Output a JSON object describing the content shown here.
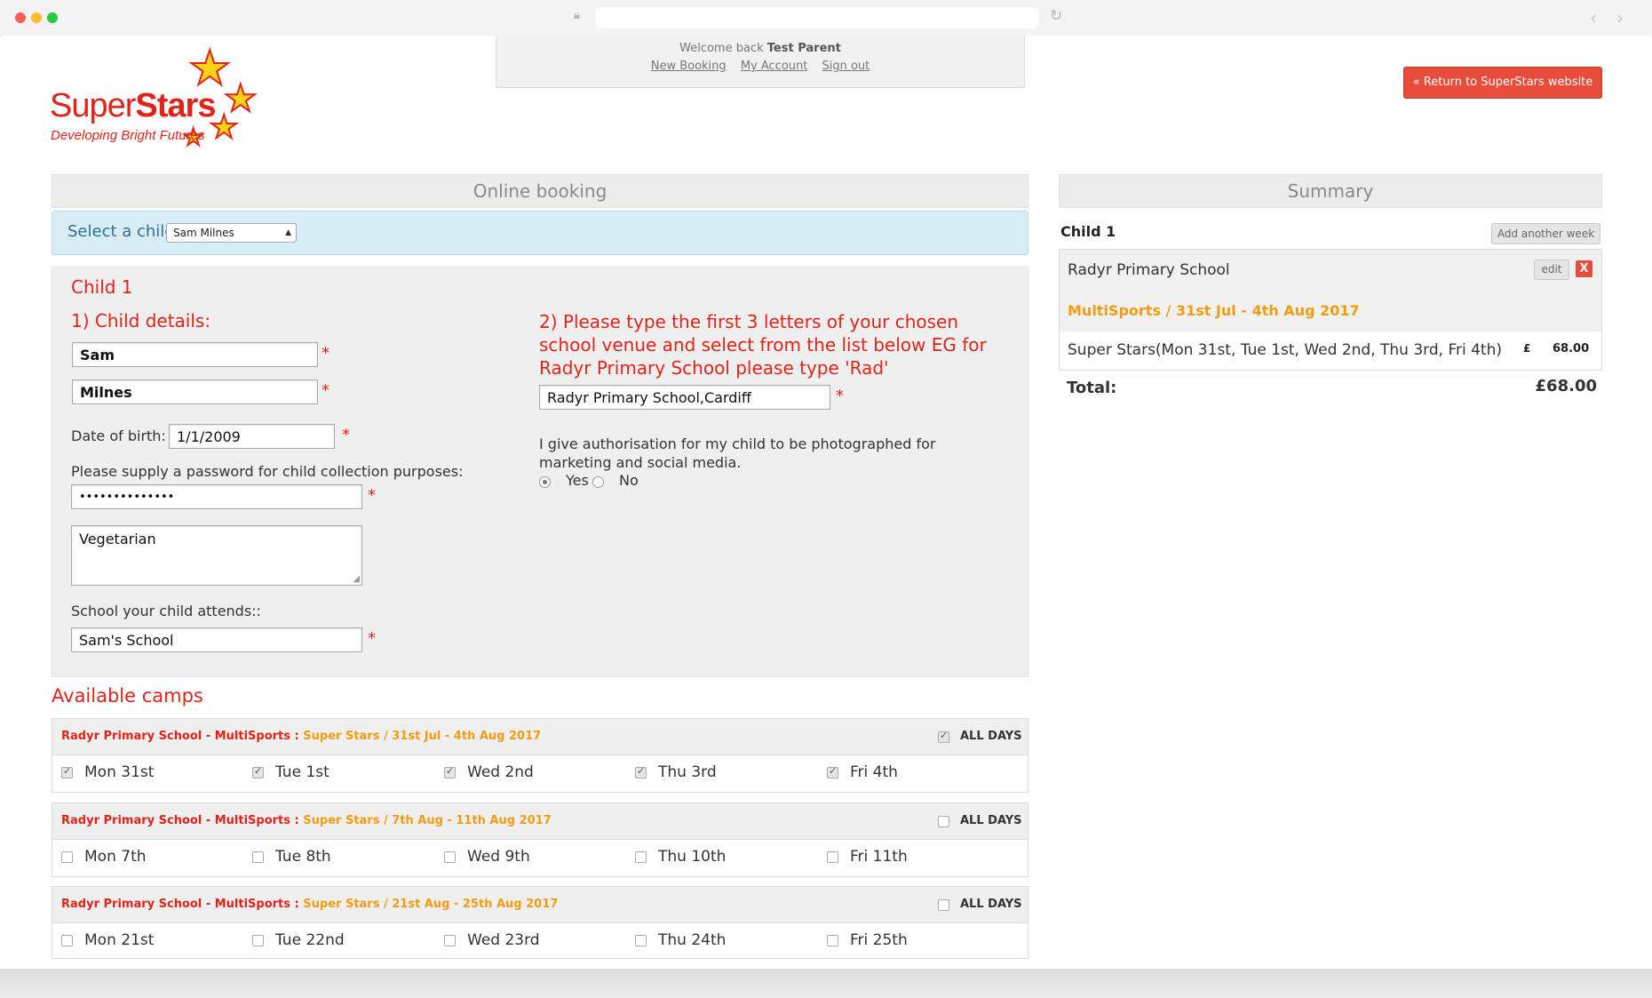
{
  "header": {
    "welcome_prefix": "Welcome back",
    "user_name": "Test Parent",
    "links": [
      "New Booking",
      "My Account",
      "Sign out"
    ],
    "return_button": "« Return to SuperStars website"
  },
  "logo": {
    "name_regular": "Super",
    "name_bold": "Stars",
    "tagline": "Developing Bright Futures"
  },
  "booking": {
    "title": "Online booking",
    "select_child_label": "Select a child",
    "select_child_value": "Sam Milnes",
    "child_title": "Child 1",
    "section1_title": "1) Child details:",
    "first_name": "Sam",
    "last_name": "Milnes",
    "dob_label": "Date of birth:",
    "dob_value": "1/1/2009",
    "password_label": "Please supply a password for child collection purposes:",
    "password_value": "••••••••••••••",
    "notes_value": "Vegetarian",
    "school_label": "School your child attends::",
    "school_value": "Sam's School",
    "section2_title": "2) Please type the first 3 letters of your chosen school venue and select from the list below EG for Radyr Primary School please type 'Rad'",
    "venue_value": "Radyr Primary School,Cardiff",
    "photo_consent_text": "I give authorisation for my child to be photographed for marketing and social media.",
    "photo_yes": "Yes",
    "photo_no": "No",
    "photo_selected": "Yes",
    "required_mark": "*"
  },
  "camps": {
    "title": "Available camps",
    "all_days_label": "ALL DAYS",
    "items": [
      {
        "venue": "Radyr Primary School - MultiSports",
        "week": "Super Stars / 31st Jul - 4th Aug 2017",
        "all_checked": true,
        "days": [
          {
            "label": "Mon 31st",
            "checked": true
          },
          {
            "label": "Tue 1st",
            "checked": true
          },
          {
            "label": "Wed 2nd",
            "checked": true
          },
          {
            "label": "Thu 3rd",
            "checked": true
          },
          {
            "label": "Fri 4th",
            "checked": true
          }
        ]
      },
      {
        "venue": "Radyr Primary School - MultiSports",
        "week": "Super Stars / 7th Aug - 11th Aug 2017",
        "all_checked": false,
        "days": [
          {
            "label": "Mon 7th",
            "checked": false
          },
          {
            "label": "Tue 8th",
            "checked": false
          },
          {
            "label": "Wed 9th",
            "checked": false
          },
          {
            "label": "Thu 10th",
            "checked": false
          },
          {
            "label": "Fri 11th",
            "checked": false
          }
        ]
      },
      {
        "venue": "Radyr Primary School - MultiSports",
        "week": "Super Stars / 21st Aug - 25th Aug 2017",
        "all_checked": false,
        "days": [
          {
            "label": "Mon 21st",
            "checked": false
          },
          {
            "label": "Tue 22nd",
            "checked": false
          },
          {
            "label": "Wed 23rd",
            "checked": false
          },
          {
            "label": "Thu 24th",
            "checked": false
          },
          {
            "label": "Fri 25th",
            "checked": false
          }
        ]
      }
    ]
  },
  "summary": {
    "title": "Summary",
    "child_label": "Child 1",
    "add_week_button": "Add another week",
    "school": "Radyr Primary School",
    "edit_button": "edit",
    "remove_button": "X",
    "camp_title": "MultiSports / 31st Jul - 4th Aug 2017",
    "line_item": "Super Stars(Mon 31st, Tue 1st, Wed 2nd, Thu 3rd, Fri 4th)",
    "currency_symbol": "£",
    "line_amount": "68.00",
    "total_label": "Total:",
    "total_value": "£68.00"
  },
  "colors": {
    "brand_red": "#e2231a",
    "accent_orange": "#f39c12",
    "info_blue": "#31708f",
    "button_red": "#e74c3c"
  }
}
